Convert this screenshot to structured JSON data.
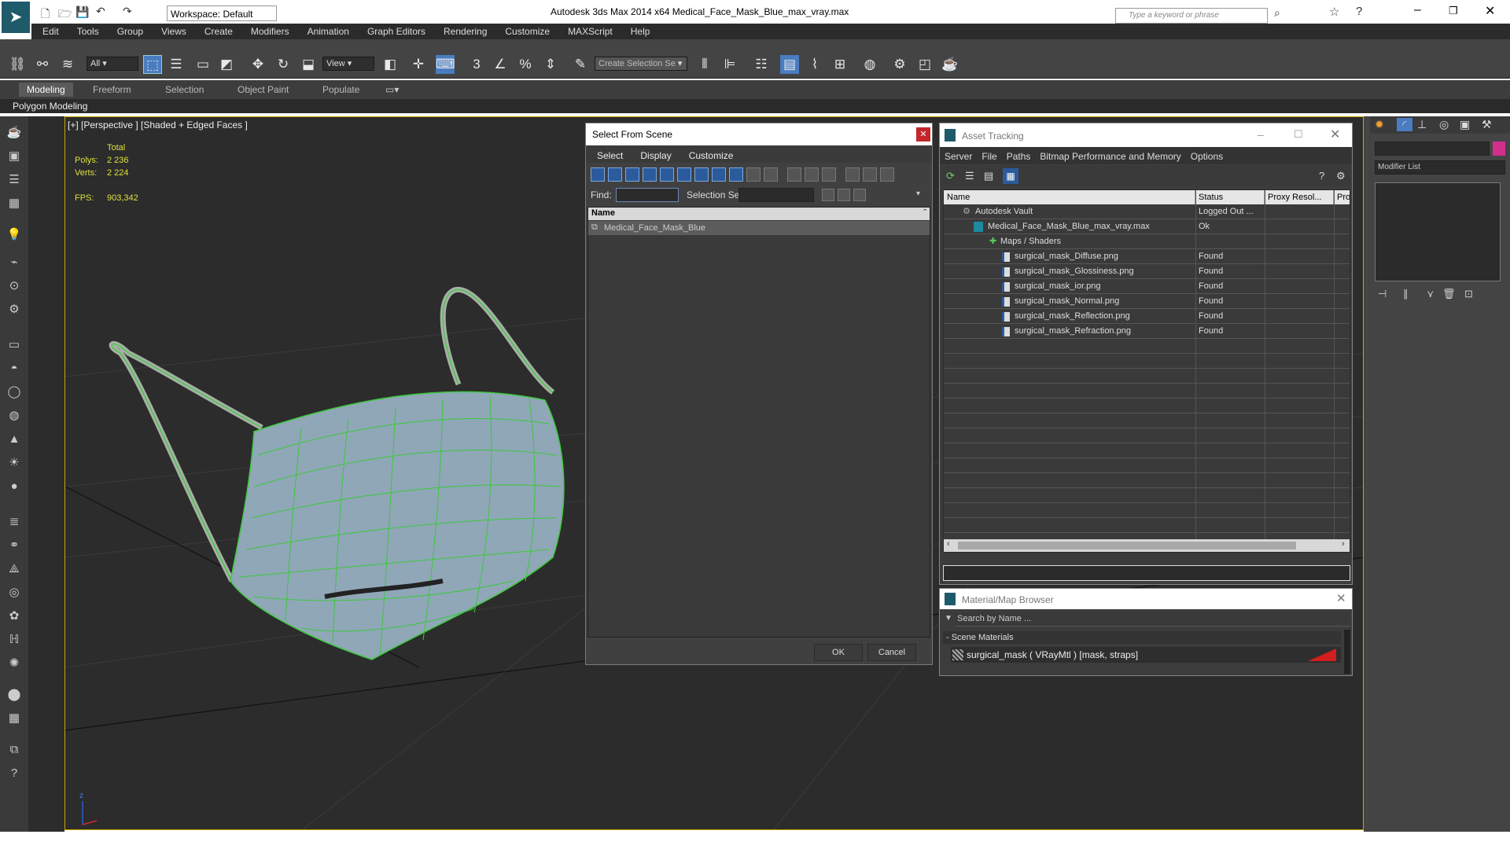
{
  "app": {
    "title": "Autodesk 3ds Max  2014 x64     Medical_Face_Mask_Blue_max_vray.max",
    "workspace": "Workspace: Default",
    "search_placeholder": "Type a keyword or phrase"
  },
  "menu": [
    "Edit",
    "Tools",
    "Group",
    "Views",
    "Create",
    "Modifiers",
    "Animation",
    "Graph Editors",
    "Rendering",
    "Customize",
    "MAXScript",
    "Help"
  ],
  "toolbar": {
    "filter": "All",
    "view": "View",
    "selection_set": "Create Selection Se"
  },
  "ribbon": {
    "tabs": [
      "Modeling",
      "Freeform",
      "Selection",
      "Object Paint",
      "Populate"
    ],
    "sub": "Polygon Modeling"
  },
  "viewport": {
    "label": "[+] [Perspective ] [Shaded + Edged Faces ]",
    "total_label": "Total",
    "polys_label": "Polys:",
    "polys": "2 236",
    "verts_label": "Verts:",
    "verts": "2 224",
    "fps_label": "FPS:",
    "fps": "903,342"
  },
  "select_from_scene": {
    "title": "Select From Scene",
    "menu": [
      "Select",
      "Display",
      "Customize"
    ],
    "find_label": "Find:",
    "selection_set_label": "Selection Set:",
    "column": "Name",
    "items": [
      "Medical_Face_Mask_Blue"
    ],
    "ok": "OK",
    "cancel": "Cancel"
  },
  "asset_tracking": {
    "title": "Asset Tracking",
    "menu": [
      "Server",
      "File",
      "Paths",
      "Bitmap Performance and Memory",
      "Options"
    ],
    "columns": [
      "Name",
      "Status",
      "Proxy Resol...",
      "Pro"
    ],
    "rows": [
      {
        "name": "Autodesk Vault",
        "status": "Logged Out ..."
      },
      {
        "name": "Medical_Face_Mask_Blue_max_vray.max",
        "status": "Ok"
      },
      {
        "name": "Maps / Shaders",
        "status": ""
      },
      {
        "name": "surgical_mask_Diffuse.png",
        "status": "Found"
      },
      {
        "name": "surgical_mask_Glossiness.png",
        "status": "Found"
      },
      {
        "name": "surgical_mask_ior.png",
        "status": "Found"
      },
      {
        "name": "surgical_mask_Normal.png",
        "status": "Found"
      },
      {
        "name": "surgical_mask_Reflection.png",
        "status": "Found"
      },
      {
        "name": "surgical_mask_Refraction.png",
        "status": "Found"
      }
    ]
  },
  "material_browser": {
    "title": "Material/Map Browser",
    "search_placeholder": "Search by Name ...",
    "section": "- Scene Materials",
    "material": "surgical_mask  ( VRayMtl ) [mask, straps]"
  },
  "command_panel": {
    "modifier_list": "Modifier List"
  },
  "colors": {
    "accent": "#2b5b9c",
    "wire": "#3cc83c",
    "viewport_border": "#c8a800"
  }
}
